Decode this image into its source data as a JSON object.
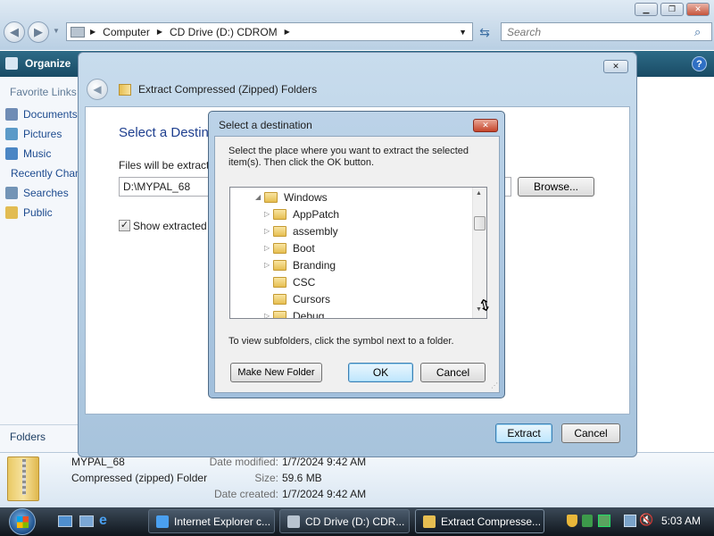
{
  "explorer": {
    "breadcrumb": [
      "Computer",
      "CD Drive (D:) CDROM"
    ],
    "search_placeholder": "Search",
    "toolbar": {
      "organize_label": "Organize"
    },
    "favorite_links_heading": "Favorite Links",
    "favorites": [
      "Documents",
      "Pictures",
      "Music",
      "Recently Changed",
      "Searches",
      "Public"
    ],
    "folders_label": "Folders",
    "details": {
      "name": "MYPAL_68",
      "type": "Compressed (zipped) Folder",
      "date_modified_label": "Date modified:",
      "date_modified": "1/7/2024 9:42 AM",
      "size_label": "Size:",
      "size": "59.6 MB",
      "date_created_label": "Date created:",
      "date_created": "1/7/2024 9:42 AM"
    }
  },
  "wizard": {
    "title": "Extract Compressed (Zipped) Folders",
    "heading": "Select a Destination and Extract Files",
    "files_label": "Files will be extracted to this folder:",
    "path_value": "D:\\MYPAL_68",
    "browse_label": "Browse...",
    "show_files_label": "Show extracted files when complete",
    "show_files_checked": true,
    "extract_label": "Extract",
    "cancel_label": "Cancel"
  },
  "dialog": {
    "title": "Select a destination",
    "instruction": "Select the place where you want to extract the selected item(s).  Then click the OK button.",
    "tree_items": [
      {
        "label": "Windows",
        "expanded": true,
        "level": 0
      },
      {
        "label": "AppPatch",
        "expanded": false,
        "level": 1
      },
      {
        "label": "assembly",
        "expanded": false,
        "level": 1
      },
      {
        "label": "Boot",
        "expanded": false,
        "level": 1
      },
      {
        "label": "Branding",
        "expanded": false,
        "level": 1
      },
      {
        "label": "CSC",
        "expanded": null,
        "level": 1
      },
      {
        "label": "Cursors",
        "expanded": null,
        "level": 1
      },
      {
        "label": "Debug",
        "expanded": false,
        "level": 1
      }
    ],
    "hint": "To view subfolders, click the symbol next to a folder.",
    "new_folder_label": "Make New Folder",
    "ok_label": "OK",
    "cancel_label": "Cancel"
  },
  "taskbar": {
    "tasks": [
      "Internet Explorer c...",
      "CD Drive (D:) CDR...",
      "Extract Compresse..."
    ],
    "clock": "5:03 AM"
  },
  "colors": {
    "accent": "#3c7fb1",
    "toolbar": "#1f5670",
    "taskbar": "#1a232d"
  }
}
